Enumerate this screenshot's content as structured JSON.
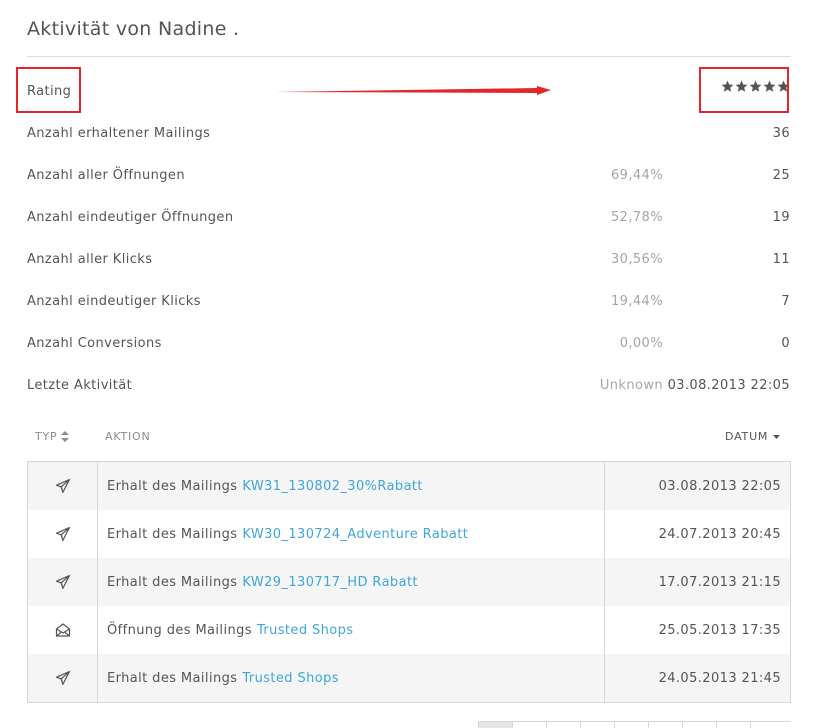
{
  "page": {
    "title": "Aktivität von Nadine ."
  },
  "stats": {
    "rating_label": "Rating",
    "rating_stars": 5,
    "rows": [
      {
        "label": "Anzahl erhaltener Mailings",
        "pct": "",
        "value": "36"
      },
      {
        "label": "Anzahl aller Öffnungen",
        "pct": "69,44%",
        "value": "25"
      },
      {
        "label": "Anzahl eindeutiger Öffnungen",
        "pct": "52,78%",
        "value": "19"
      },
      {
        "label": "Anzahl aller Klicks",
        "pct": "30,56%",
        "value": "11"
      },
      {
        "label": "Anzahl eindeutiger Klicks",
        "pct": "19,44%",
        "value": "7"
      },
      {
        "label": "Anzahl Conversions",
        "pct": "0,00%",
        "value": "0"
      }
    ],
    "last_activity": {
      "label": "Letzte Aktivität",
      "location": "Unknown",
      "datetime": "03.08.2013 22:05"
    }
  },
  "table": {
    "headers": {
      "typ": "TYP",
      "aktion": "AKTION",
      "datum": "DATUM"
    },
    "rows": [
      {
        "icon": "paper-plane-icon",
        "action": "Erhalt des Mailings",
        "link": "KW31_130802_30%Rabatt",
        "date": "03.08.2013 22:05"
      },
      {
        "icon": "paper-plane-icon",
        "action": "Erhalt des Mailings",
        "link": "KW30_130724_Adventure Rabatt",
        "date": "24.07.2013 20:45"
      },
      {
        "icon": "paper-plane-icon",
        "action": "Erhalt des Mailings",
        "link": "KW29_130717_HD Rabatt",
        "date": "17.07.2013 21:15"
      },
      {
        "icon": "open-envelope-icon",
        "action": "Öffnung des Mailings",
        "link": "Trusted Shops",
        "date": "25.05.2013 17:35"
      },
      {
        "icon": "paper-plane-icon",
        "action": "Erhalt des Mailings",
        "link": "Trusted Shops",
        "date": "24.05.2013 21:45"
      }
    ]
  },
  "colors": {
    "link": "#3fa6db",
    "annotation": "#e4262b",
    "star": "#555555"
  }
}
